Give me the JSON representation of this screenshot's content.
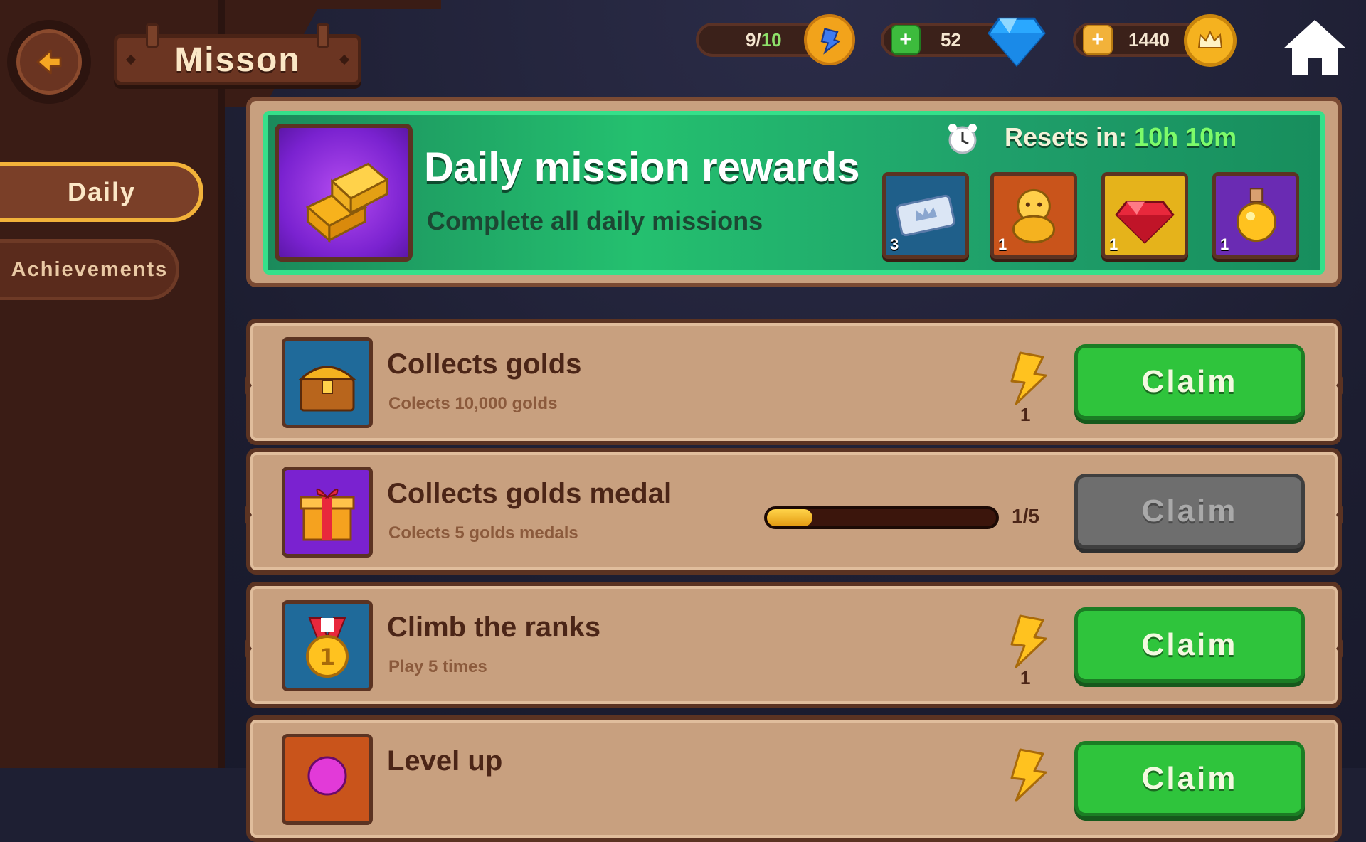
{
  "header": {
    "title": "Misson",
    "energy": {
      "value": "9/",
      "max": "10"
    },
    "gems": "52",
    "gold": "1440"
  },
  "tabs": [
    {
      "label": "Daily",
      "active": true
    },
    {
      "label": "Achievements",
      "active": false
    }
  ],
  "reward_panel": {
    "title": "Daily mission rewards",
    "subtitle": "Complete all daily missions",
    "reset_label": "Resets in:",
    "reset_value": "10h 10m",
    "items": [
      {
        "icon": "ticket-icon",
        "count": "3",
        "bg": "#1f5f8a"
      },
      {
        "icon": "golden-idol-icon",
        "count": "1",
        "bg": "#c9541b"
      },
      {
        "icon": "red-gem-icon",
        "count": "1",
        "bg": "#e5b31b"
      },
      {
        "icon": "potion-icon",
        "count": "1",
        "bg": "#6a2bb3"
      }
    ]
  },
  "missions": [
    {
      "title": "Collects golds",
      "desc": "Colects 10,000 golds",
      "icon": "treasure-chest-icon",
      "reward_count": "1",
      "claim_label": "Claim",
      "claimable": true
    },
    {
      "title": "Collects golds medal",
      "desc": "Colects 5 golds medals",
      "icon": "gift-box-icon",
      "progress_text": "1/5",
      "progress": 0.2,
      "claim_label": "Claim",
      "claimable": false
    },
    {
      "title": "Climb the ranks",
      "desc": "Play 5 times",
      "icon": "medal-icon",
      "reward_count": "1",
      "claim_label": "Claim",
      "claimable": true
    },
    {
      "title": "Level up",
      "icon": "gem-icon",
      "claim_label": "Claim",
      "claimable": true
    }
  ],
  "colors": {
    "accent_green": "#2fc43c",
    "tab_highlight": "#f2b23a",
    "reset_green": "#7dfb6a"
  }
}
